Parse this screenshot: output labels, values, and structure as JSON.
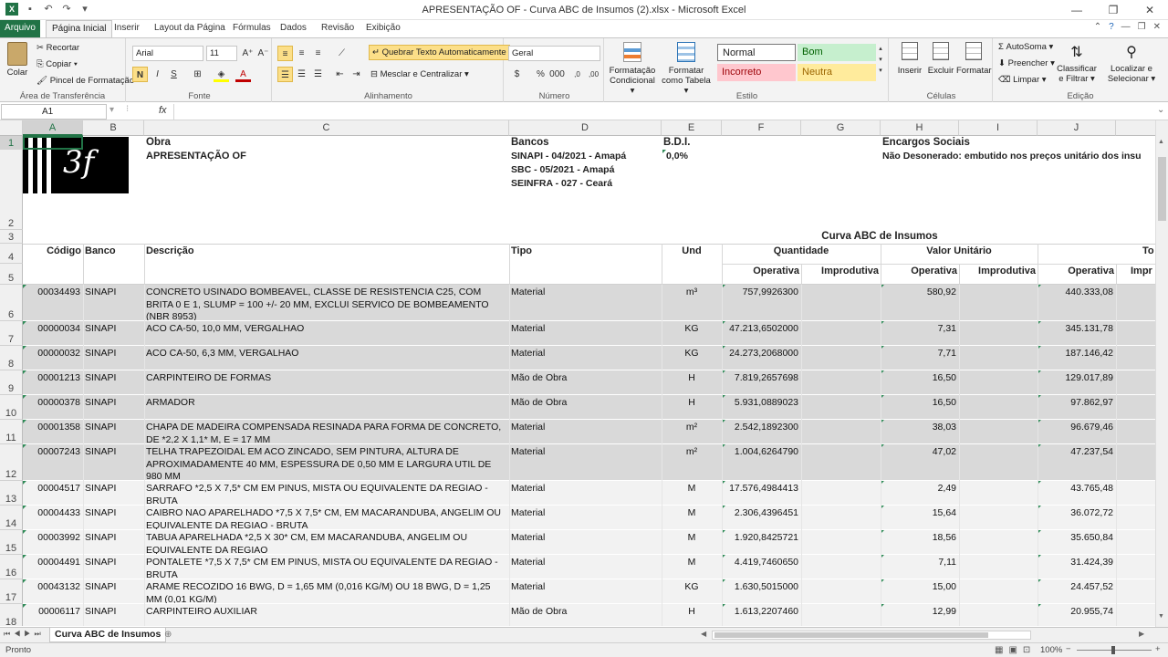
{
  "window": {
    "title": "APRESENTAÇÃO OF - Curva ABC de Insumos (2).xlsx - Microsoft Excel"
  },
  "tabs": [
    "Arquivo",
    "Página Inicial",
    "Inserir",
    "Layout da Página",
    "Fórmulas",
    "Dados",
    "Revisão",
    "Exibição"
  ],
  "ribbon": {
    "clipboard": {
      "paste": "Colar",
      "cut": "Recortar",
      "copy": "Copiar ▾",
      "painter": "Pincel de Formatação",
      "label": "Área de Transferência"
    },
    "font": {
      "name": "Arial",
      "size": "11",
      "label": "Fonte"
    },
    "align": {
      "wrap": "Quebrar Texto Automaticamente",
      "merge": "Mesclar e Centralizar ▾",
      "label": "Alinhamento"
    },
    "number": {
      "format": "Geral",
      "label": "Número"
    },
    "styles": {
      "cond": "Formatação Condicional ▾",
      "table": "Formatar como Tabela ▾",
      "normal": "Normal",
      "bom": "Bom",
      "incorreto": "Incorreto",
      "neutra": "Neutra",
      "label": "Estilo"
    },
    "cells": {
      "insert": "Inserir",
      "delete": "Excluir",
      "format": "Formatar",
      "label": "Células"
    },
    "edit": {
      "autosum": "AutoSoma ▾",
      "fill": "Preencher ▾",
      "clear": "Limpar ▾",
      "sort": "Classificar e Filtrar ▾",
      "find": "Localizar e Selecionar ▾",
      "label": "Edição"
    }
  },
  "formula_bar": {
    "name_box": "A1",
    "fx": "fx",
    "value": ""
  },
  "columns": [
    "A",
    "B",
    "C",
    "D",
    "E",
    "F",
    "G",
    "H",
    "I",
    "J"
  ],
  "header": {
    "obra_label": "Obra",
    "obra_value": "APRESENTAÇÃO OF",
    "bancos_label": "Bancos",
    "bancos": [
      "SINAPI - 04/2021 - Amapá",
      "SBC - 05/2021 - Amapá",
      "SEINFRA - 027 - Ceará"
    ],
    "bdi_label": "B.D.I.",
    "bdi_value": "0,0%",
    "encargos_label": "Encargos Sociais",
    "encargos_value": "Não Desonerado: embutido nos preços unitário dos insu",
    "logo_text": "3f",
    "report_title": "Curva ABC de Insumos"
  },
  "table_head": {
    "codigo": "Código",
    "banco": "Banco",
    "descricao": "Descrição",
    "tipo": "Tipo",
    "und": "Und",
    "quantidade": "Quantidade",
    "valor_unit": "Valor  Unitário",
    "total": "To",
    "operativa": "Operativa",
    "improdutiva": "Improdutiva",
    "impr": "Impr"
  },
  "rows": [
    {
      "n": "6",
      "codigo": "00034493",
      "banco": "SINAPI",
      "desc": "CONCRETO USINADO BOMBEAVEL, CLASSE DE RESISTENCIA C25, COM BRITA 0 E 1, SLUMP = 100 +/- 20 MM, EXCLUI SERVICO DE BOMBEAMENTO (NBR 8953)",
      "tipo": "Material",
      "und": "m³",
      "qtd": "757,9926300",
      "vu": "580,92",
      "total": "440.333,08"
    },
    {
      "n": "7",
      "codigo": "00000034",
      "banco": "SINAPI",
      "desc": "ACO CA-50, 10,0 MM, VERGALHAO",
      "tipo": "Material",
      "und": "KG",
      "qtd": "47.213,6502000",
      "vu": "7,31",
      "total": "345.131,78"
    },
    {
      "n": "8",
      "codigo": "00000032",
      "banco": "SINAPI",
      "desc": "ACO CA-50, 6,3 MM, VERGALHAO",
      "tipo": "Material",
      "und": "KG",
      "qtd": "24.273,2068000",
      "vu": "7,71",
      "total": "187.146,42"
    },
    {
      "n": "9",
      "codigo": "00001213",
      "banco": "SINAPI",
      "desc": "CARPINTEIRO DE FORMAS",
      "tipo": "Mão de Obra",
      "und": "H",
      "qtd": "7.819,2657698",
      "vu": "16,50",
      "total": "129.017,89"
    },
    {
      "n": "10",
      "codigo": "00000378",
      "banco": "SINAPI",
      "desc": "ARMADOR",
      "tipo": "Mão de Obra",
      "und": "H",
      "qtd": "5.931,0889023",
      "vu": "16,50",
      "total": "97.862,97"
    },
    {
      "n": "11",
      "codigo": "00001358",
      "banco": "SINAPI",
      "desc": "CHAPA DE MADEIRA COMPENSADA RESINADA PARA FORMA DE CONCRETO, DE *2,2 X 1,1* M, E = 17 MM",
      "tipo": "Material",
      "und": "m²",
      "qtd": "2.542,1892300",
      "vu": "38,03",
      "total": "96.679,46"
    },
    {
      "n": "12",
      "codigo": "00007243",
      "banco": "SINAPI",
      "desc": "TELHA TRAPEZOIDAL EM ACO ZINCADO, SEM PINTURA, ALTURA DE APROXIMADAMENTE 40 MM, ESPESSURA DE 0,50 MM E LARGURA UTIL DE 980 MM",
      "tipo": "Material",
      "und": "m²",
      "qtd": "1.004,6264790",
      "vu": "47,02",
      "total": "47.237,54"
    },
    {
      "n": "13",
      "codigo": "00004517",
      "banco": "SINAPI",
      "desc": "SARRAFO *2,5 X 7,5* CM EM PINUS, MISTA OU EQUIVALENTE DA REGIAO - BRUTA",
      "tipo": "Material",
      "und": "M",
      "qtd": "17.576,4984413",
      "vu": "2,49",
      "total": "43.765,48"
    },
    {
      "n": "14",
      "codigo": "00004433",
      "banco": "SINAPI",
      "desc": "CAIBRO NAO APARELHADO  *7,5 X 7,5* CM, EM MACARANDUBA, ANGELIM OU EQUIVALENTE DA REGIAO -  BRUTA",
      "tipo": "Material",
      "und": "M",
      "qtd": "2.306,4396451",
      "vu": "15,64",
      "total": "36.072,72"
    },
    {
      "n": "15",
      "codigo": "00003992",
      "banco": "SINAPI",
      "desc": "TABUA APARELHADA *2,5 X 30* CM, EM MACARANDUBA, ANGELIM OU EQUIVALENTE DA REGIAO",
      "tipo": "Material",
      "und": "M",
      "qtd": "1.920,8425721",
      "vu": "18,56",
      "total": "35.650,84"
    },
    {
      "n": "16",
      "codigo": "00004491",
      "banco": "SINAPI",
      "desc": "PONTALETE *7,5 X 7,5* CM EM PINUS, MISTA OU EQUIVALENTE DA REGIAO - BRUTA",
      "tipo": "Material",
      "und": "M",
      "qtd": "4.419,7460650",
      "vu": "7,11",
      "total": "31.424,39"
    },
    {
      "n": "17",
      "codigo": "00043132",
      "banco": "SINAPI",
      "desc": "ARAME RECOZIDO 16 BWG, D = 1,65 MM (0,016 KG/M) OU 18 BWG, D = 1,25 MM (0,01 KG/M)",
      "tipo": "Material",
      "und": "KG",
      "qtd": "1.630,5015000",
      "vu": "15,00",
      "total": "24.457,52"
    },
    {
      "n": "18",
      "codigo": "00006117",
      "banco": "SINAPI",
      "desc": "CARPINTEIRO AUXILIAR",
      "tipo": "Mão de Obra",
      "und": "H",
      "qtd": "1.613,2207460",
      "vu": "12,99",
      "total": "20.955,74"
    }
  ],
  "row_numbers": [
    "1",
    "2",
    "3",
    "4",
    "5"
  ],
  "sheet_tab": "Curva ABC de Insumos",
  "status": {
    "ready": "Pronto",
    "zoom": "100%"
  },
  "colors": {
    "excel_green": "#217346",
    "row_gray": "#d9d9d9",
    "row_light": "#f2f2f2"
  }
}
